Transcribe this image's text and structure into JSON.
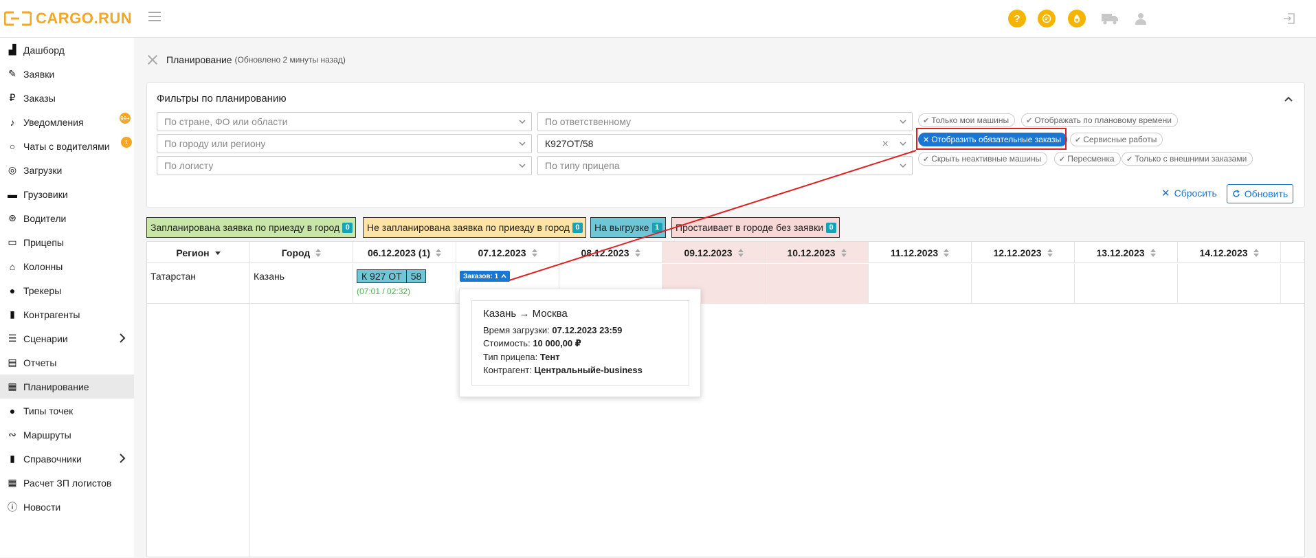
{
  "header": {
    "logo_text": "CARGO.RUN",
    "brand_color": "#f5a623",
    "icons": [
      "help-icon",
      "chat-icon",
      "money-icon",
      "truck-icon",
      "user-icon",
      "logout-icon"
    ]
  },
  "sidebar": {
    "items": [
      {
        "label": "Дашборд",
        "icon": "dashboard-icon"
      },
      {
        "label": "Заявки",
        "icon": "edit-icon"
      },
      {
        "label": "Заказы",
        "icon": "ruble-icon"
      },
      {
        "label": "Уведомления",
        "icon": "bell-icon",
        "badge": "99+"
      },
      {
        "label": "Чаты с водителями",
        "icon": "chat-icon",
        "badge": "1"
      },
      {
        "label": "Загрузки",
        "icon": "compass-icon"
      },
      {
        "label": "Грузовики",
        "icon": "truck-icon"
      },
      {
        "label": "Водители",
        "icon": "steering-wheel-icon"
      },
      {
        "label": "Прицепы",
        "icon": "trailer-icon"
      },
      {
        "label": "Колонны",
        "icon": "warehouse-icon"
      },
      {
        "label": "Трекеры",
        "icon": "pin-icon"
      },
      {
        "label": "Контрагенты",
        "icon": "contractor-icon"
      },
      {
        "label": "Сценарии",
        "icon": "list-icon",
        "chevron": true
      },
      {
        "label": "Отчеты",
        "icon": "clipboard-icon"
      },
      {
        "label": "Планирование",
        "icon": "calendar-icon",
        "active": true
      },
      {
        "label": "Типы точек",
        "icon": "pin-icon"
      },
      {
        "label": "Маршруты",
        "icon": "route-icon"
      },
      {
        "label": "Справочники",
        "icon": "book-icon",
        "chevron": true
      },
      {
        "label": "Расчет ЗП логистов",
        "icon": "calculator-icon"
      },
      {
        "label": "Новости",
        "icon": "info-icon"
      }
    ]
  },
  "breadcrumb": {
    "title": "Планирование",
    "subtitle": "(Обновлено 2 минуты назад)"
  },
  "filters": {
    "title": "Фильтры по планированию",
    "country_placeholder": "По стране, ФО или области",
    "responsible_placeholder": "По ответственному",
    "city_placeholder": "По городу или региону",
    "vehicle_value": "К927ОТ/58",
    "logist_placeholder": "По логисту",
    "trailer_placeholder": "По типу прицепа",
    "chips": {
      "only_my": "Только мои машины",
      "by_plan_time": "Отображать по плановому времени",
      "required_orders": "Отобразить обязательные заказы",
      "service": "Сервисные работы",
      "hide_inactive": "Скрыть неактивные машины",
      "shift_change": "Пересменка",
      "external_only": "Только с внешними заказами"
    },
    "reset_label": "Сбросить",
    "update_label": "Обновить"
  },
  "legend": [
    {
      "label": "Запланирована заявка по приезду в город",
      "count": "0",
      "color": "#c8e6a8"
    },
    {
      "label": "Не запланирована заявка по приезду в город",
      "count": "0",
      "color": "#fde4a6"
    },
    {
      "label": "На выгрузке",
      "count": "1",
      "color": "#6fc6d6"
    },
    {
      "label": "Простаивает в городе без заявки",
      "count": "0",
      "color": "#f8d7d7"
    }
  ],
  "table": {
    "columns": [
      "Регион",
      "Город",
      "06.12.2023 (1)",
      "07.12.2023",
      "08.12.2023",
      "09.12.2023",
      "10.12.2023",
      "11.12.2023",
      "12.12.2023",
      "13.12.2023",
      "14.12.2023"
    ],
    "row": {
      "region": "Татарстан",
      "city": "Казань",
      "plate_main": "К 927 ОТ",
      "plate_region": "58",
      "time": "(07:01 / 02:32)",
      "orders_badge": "Заказов: 1"
    }
  },
  "popover": {
    "route": "Казань → Москва",
    "load_time_label": "Время загрузки:",
    "load_time_value": "07.12.2023 23:59",
    "cost_label": "Стоимость:",
    "cost_value": "10 000,00 ₽",
    "trailer_label": "Тип прицепа:",
    "trailer_value": "Тент",
    "contractor_label": "Контрагент:",
    "contractor_value": "Центральныйе-business"
  }
}
